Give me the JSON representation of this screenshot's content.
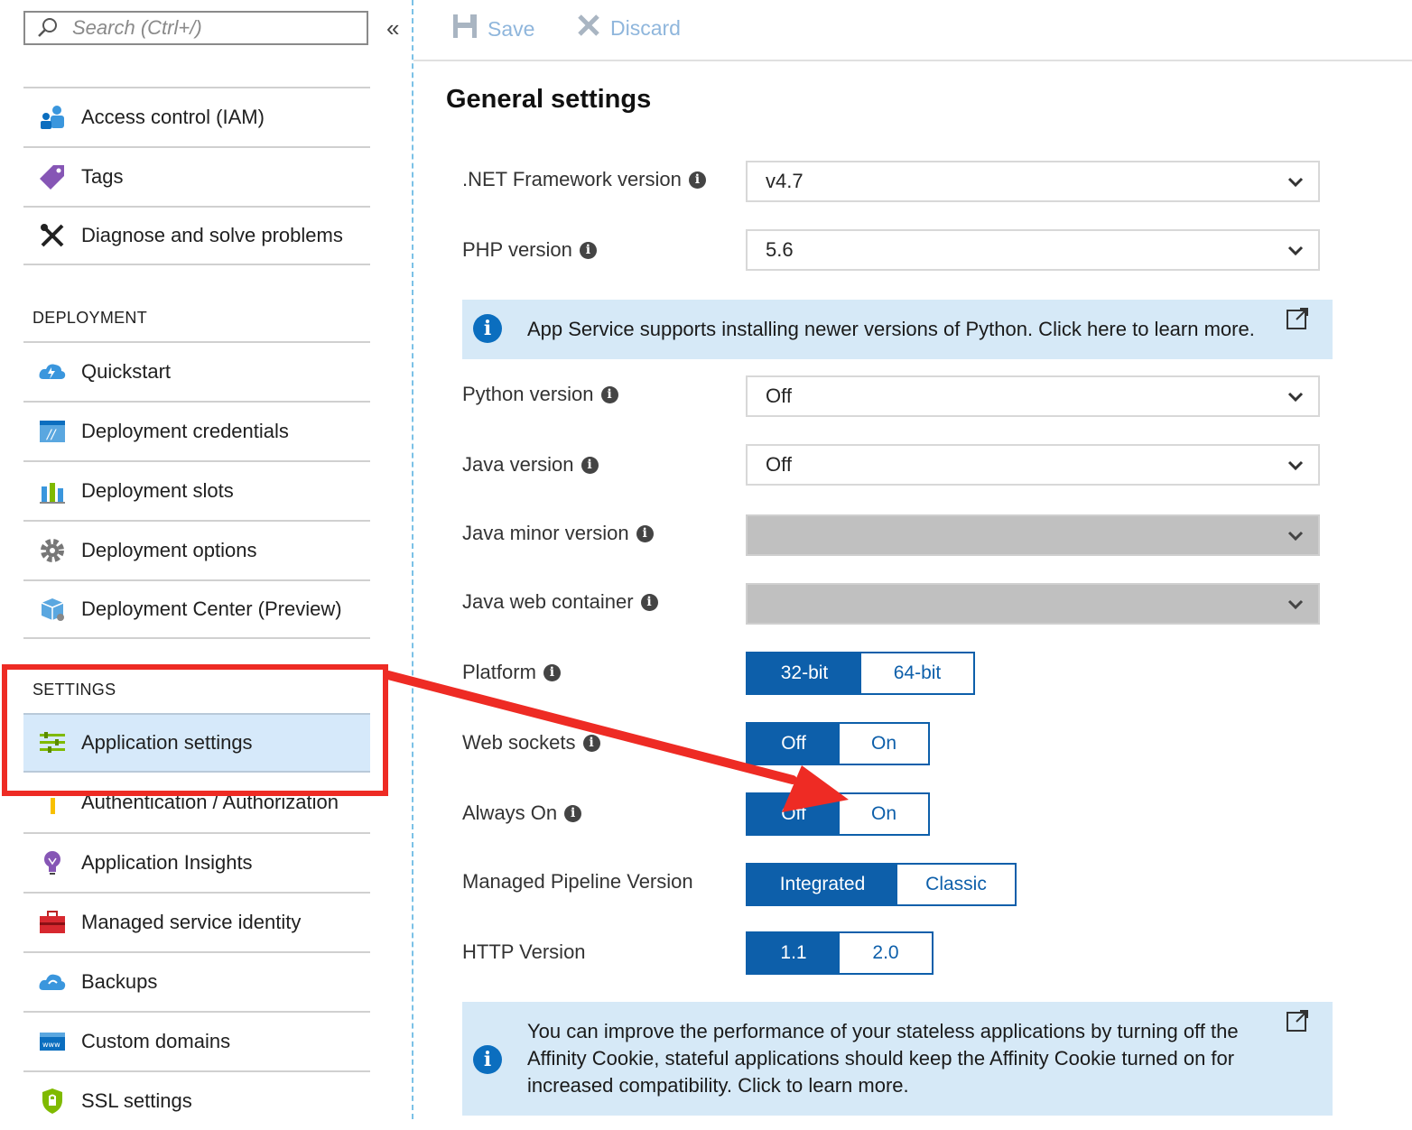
{
  "search": {
    "placeholder": "Search (Ctrl+/)"
  },
  "sidebar": {
    "items_top": [
      {
        "label": "Access control (IAM)",
        "icon": "iam-icon"
      },
      {
        "label": "Tags",
        "icon": "tag-icon"
      },
      {
        "label": "Diagnose and solve problems",
        "icon": "tools-icon"
      }
    ],
    "deployment_header": "DEPLOYMENT",
    "deployment_items": [
      {
        "label": "Quickstart",
        "icon": "cloud-lightning-icon"
      },
      {
        "label": "Deployment credentials",
        "icon": "credentials-icon"
      },
      {
        "label": "Deployment slots",
        "icon": "slots-icon"
      },
      {
        "label": "Deployment options",
        "icon": "gear-icon"
      },
      {
        "label": "Deployment Center (Preview)",
        "icon": "deployment-center-icon"
      }
    ],
    "settings_header": "SETTINGS",
    "settings_items": [
      {
        "label": "Application settings",
        "icon": "settings-list-icon",
        "active": true
      },
      {
        "label": "Authentication / Authorization",
        "icon": "key-icon"
      },
      {
        "label": "Application Insights",
        "icon": "lightbulb-icon"
      },
      {
        "label": "Managed service identity",
        "icon": "toolbox-icon"
      },
      {
        "label": "Backups",
        "icon": "cloud-backup-icon"
      },
      {
        "label": "Custom domains",
        "icon": "www-icon"
      },
      {
        "label": "SSL settings",
        "icon": "shield-lock-icon"
      }
    ]
  },
  "toolbar": {
    "save_label": "Save",
    "discard_label": "Discard"
  },
  "main": {
    "title": "General settings",
    "net_label": ".NET Framework version",
    "net_value": "v4.7",
    "php_label": "PHP version",
    "php_value": "5.6",
    "python_banner": "App Service supports installing newer versions of Python. Click here to learn more.",
    "python_label": "Python version",
    "python_value": "Off",
    "java_label": "Java version",
    "java_value": "Off",
    "java_minor_label": "Java minor version",
    "java_container_label": "Java web container",
    "platform": {
      "label": "Platform",
      "options": [
        "32-bit",
        "64-bit"
      ],
      "selected": "32-bit"
    },
    "websockets": {
      "label": "Web sockets",
      "options": [
        "Off",
        "On"
      ],
      "selected": "Off"
    },
    "always_on": {
      "label": "Always On",
      "options": [
        "Off",
        "On"
      ],
      "selected": "Off"
    },
    "pipeline": {
      "label": "Managed Pipeline Version",
      "options": [
        "Integrated",
        "Classic"
      ],
      "selected": "Integrated"
    },
    "http": {
      "label": "HTTP Version",
      "options": [
        "1.1",
        "2.0"
      ],
      "selected": "1.1"
    },
    "affinity_banner": [
      "You can improve the performance of your stateless applications by turning off the",
      "Affinity Cookie, stateful applications should keep the Affinity Cookie turned on for",
      "increased compatibility. Click to learn more."
    ]
  },
  "colors": {
    "accent": "#0d5faa",
    "highlight": "#ee2b24",
    "banner": "#d6e9f7",
    "active_nav": "#d6e9fa"
  }
}
